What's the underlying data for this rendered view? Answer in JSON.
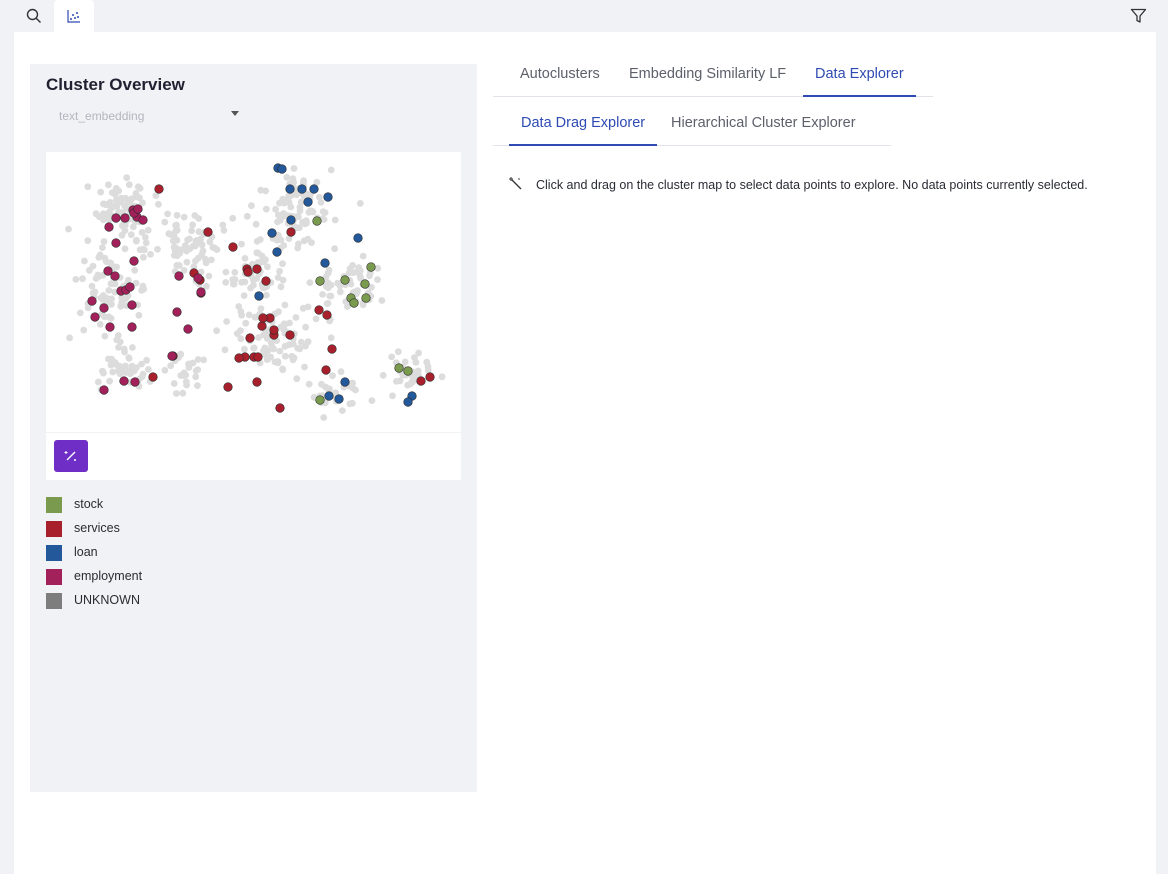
{
  "toolbar": {
    "icons": [
      "search-icon",
      "scatter-plot-icon",
      "filter-icon"
    ]
  },
  "left_panel": {
    "title": "Cluster Overview",
    "embedding_select": {
      "value": "text_embedding"
    },
    "wand_icon": "magic-wand-icon"
  },
  "legend": {
    "items": [
      {
        "label": "stock",
        "color": "#7a9a4e"
      },
      {
        "label": "services",
        "color": "#a8202c"
      },
      {
        "label": "loan",
        "color": "#23589a"
      },
      {
        "label": "employment",
        "color": "#a3215a"
      },
      {
        "label": "UNKNOWN",
        "color": "#7d7d7d"
      }
    ]
  },
  "tabs": {
    "items": [
      "Autoclusters",
      "Embedding Similarity LF",
      "Data Explorer"
    ],
    "active": "Data Explorer"
  },
  "subtabs": {
    "items": [
      "Data Drag Explorer",
      "Hierarchical Cluster Explorer"
    ],
    "active": "Data Drag Explorer"
  },
  "hint": {
    "text": "Click and drag on the cluster map to select data points to explore. No data points currently selected."
  },
  "colors": {
    "accent": "#2f4bb3",
    "wand_button": "#6f2fc6",
    "unknown_point": "#dcdcdc"
  }
}
